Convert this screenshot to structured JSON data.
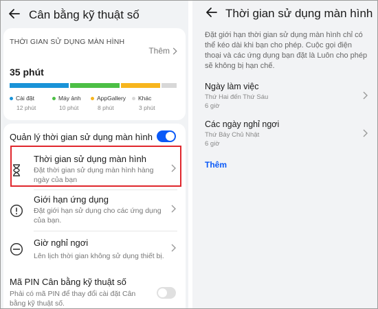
{
  "left": {
    "title": "Cân bằng kỹ thuật số",
    "usage": {
      "heading": "THỜI GIAN SỬ DỤNG MÀN HÌNH",
      "more_label": "Thêm",
      "total": "35 phút",
      "segments": [
        {
          "name": "Cài đặt",
          "time": "12 phút",
          "color": "#1a93d8",
          "minutes": 12
        },
        {
          "name": "Máy ảnh",
          "time": "10 phút",
          "color": "#4cbf45",
          "minutes": 10
        },
        {
          "name": "AppGallery",
          "time": "8 phút",
          "color": "#f7b51e",
          "minutes": 8
        },
        {
          "name": "Khác",
          "time": "3 phút",
          "color": "#d8d8d8",
          "minutes": 3
        }
      ]
    },
    "manage_label": "Quản lý thời gian sử dụng màn hình",
    "manage_on": true,
    "items": [
      {
        "title": "Thời gian sử dụng màn hình",
        "desc": "Đặt thời gian sử dụng màn hình hàng ngày của bạn",
        "icon": "hourglass-icon"
      },
      {
        "title": "Giới hạn ứng dụng",
        "desc": "Đặt giới hạn sử dụng cho các ứng dụng của bạn.",
        "icon": "info-circle-icon"
      },
      {
        "title": "Giờ nghỉ ngơi",
        "desc": "Lên lịch thời gian không sử dụng thiết bị.",
        "icon": "minus-circle-icon"
      }
    ],
    "pin": {
      "title": "Mã PIN Cân bằng kỹ thuật số",
      "desc": "Phải có mã PIN để thay đổi cài đặt Cân bằng kỹ thuật số.",
      "on": false
    }
  },
  "right": {
    "title": "Thời gian sử dụng màn hình",
    "description": "Đặt giới hạn thời gian sử dụng màn hình chỉ có thể kéo dài khi bạn cho phép. Cuộc gọi điện thoại và các ứng dụng bạn đặt là Luôn cho phép sẽ không bị hạn chế.",
    "rows": [
      {
        "title": "Ngày làm việc",
        "days": "Thứ Hai đến Thứ Sáu",
        "hours": "6 giờ"
      },
      {
        "title": "Các ngày nghỉ ngơi",
        "days": "Thứ Bảy Chủ Nhật",
        "hours": "6 giờ"
      }
    ],
    "add_label": "Thêm"
  }
}
